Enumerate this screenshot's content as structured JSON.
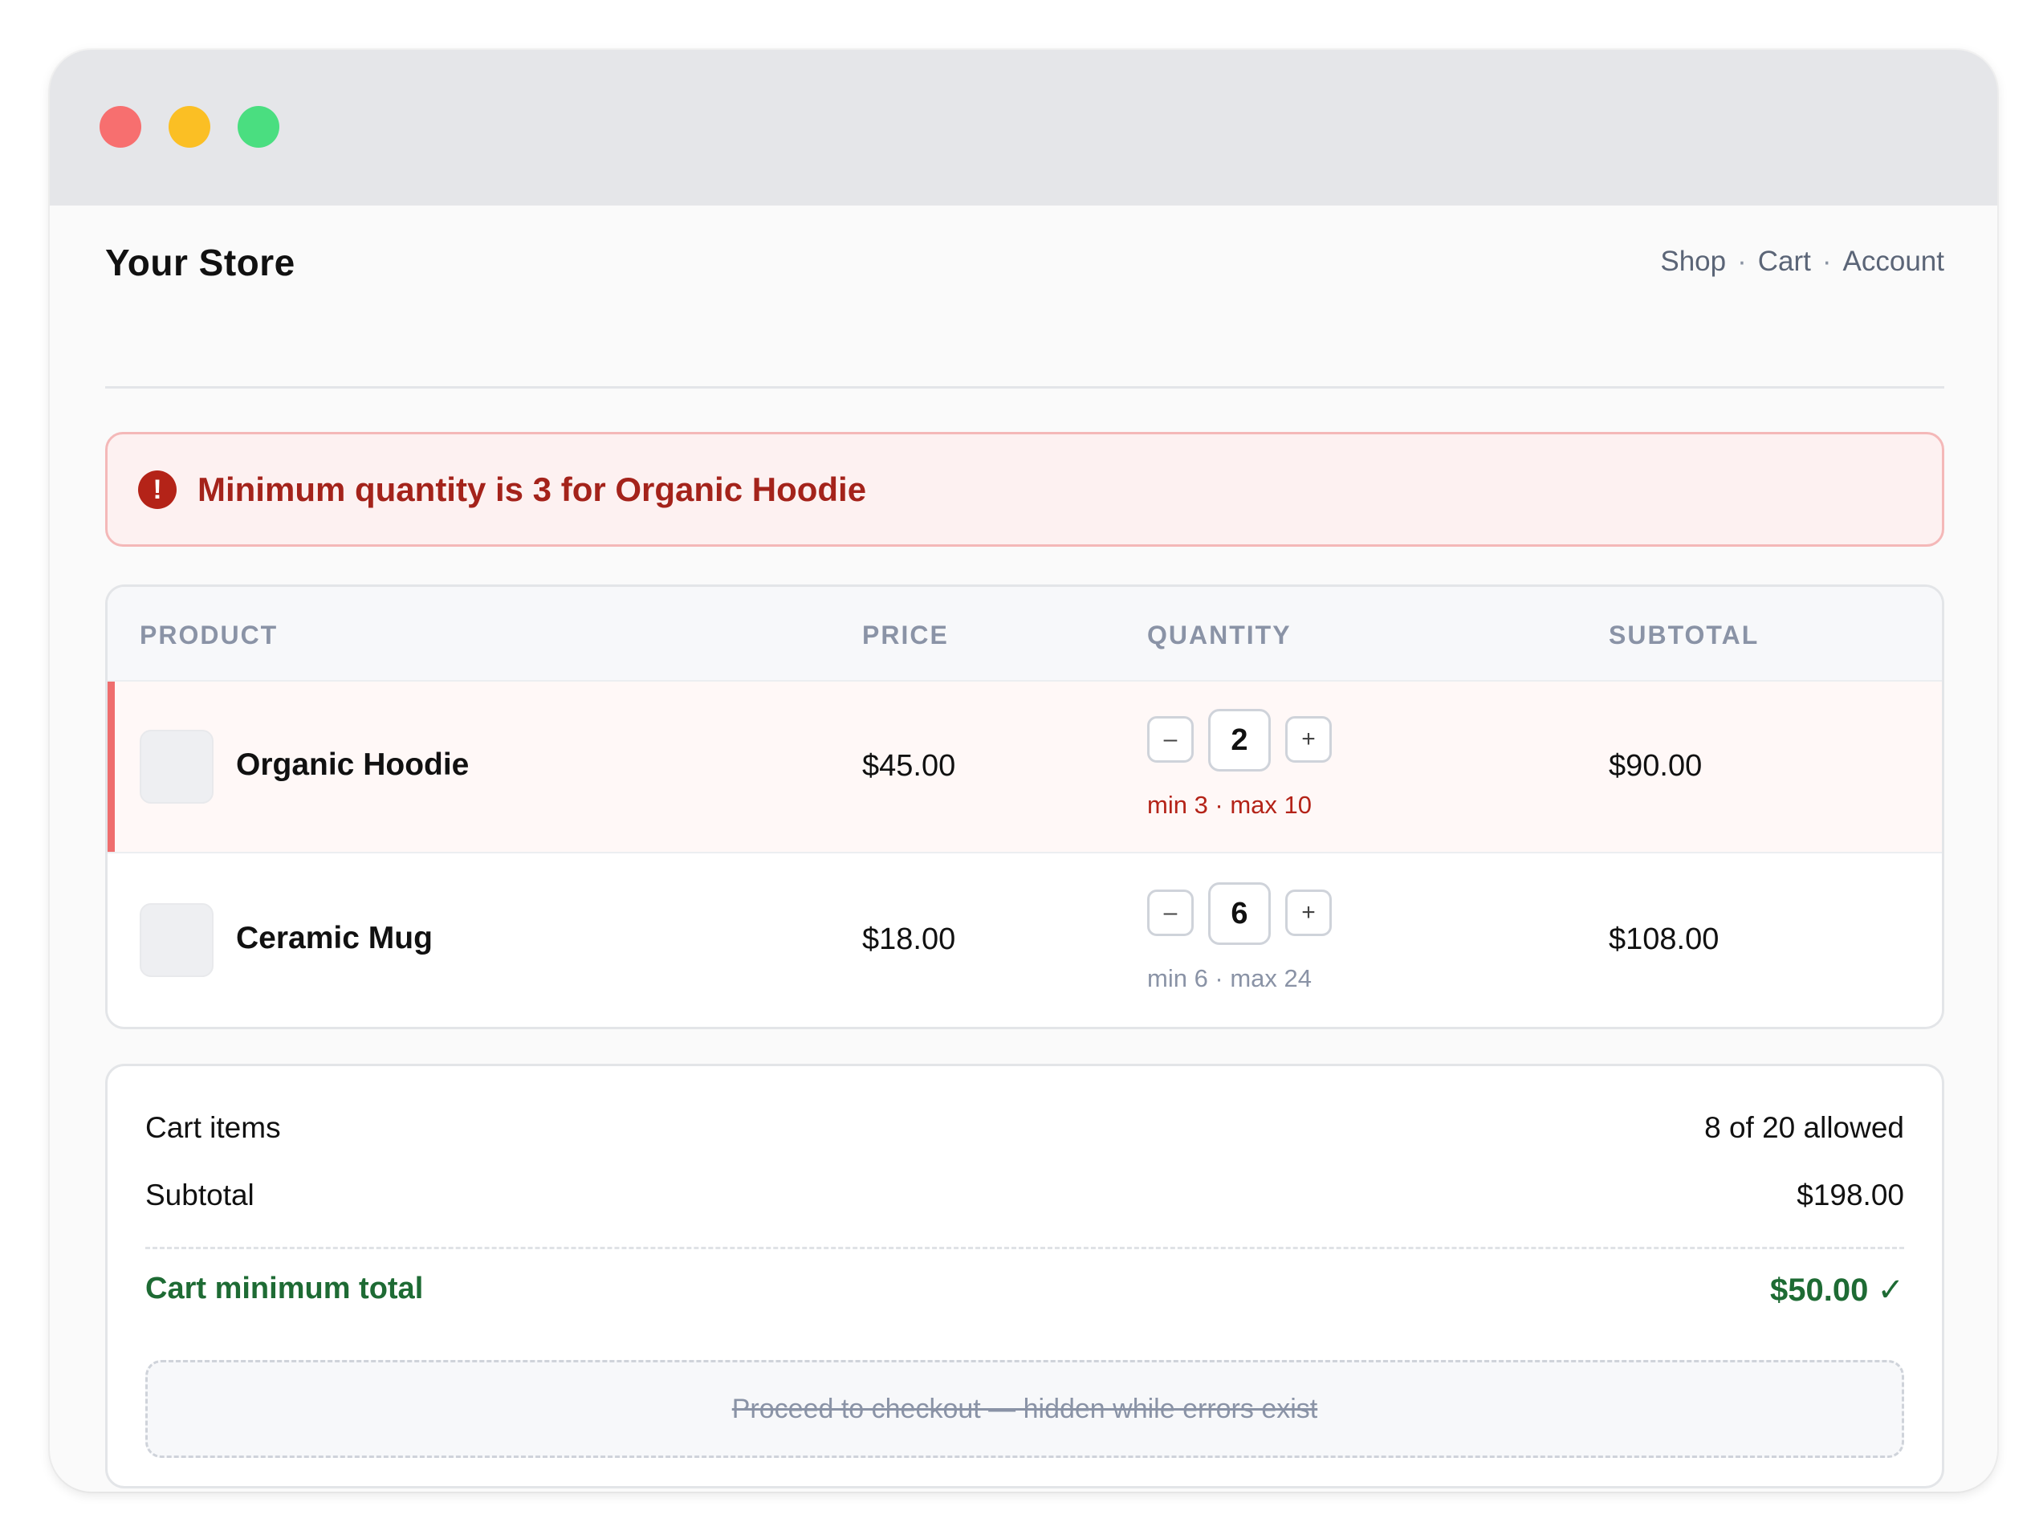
{
  "window": {
    "controls": [
      "close",
      "minimize",
      "maximize"
    ],
    "colors": {
      "close": "#f76f6f",
      "minimize": "#fbbf24",
      "maximize": "#4ade80"
    }
  },
  "header": {
    "brand": "Your Store",
    "nav": [
      {
        "label": "Shop"
      },
      {
        "label": "Cart"
      },
      {
        "label": "Account"
      }
    ],
    "nav_separator": "·"
  },
  "alert": {
    "icon": "error-exclamation-icon",
    "icon_glyph": "!",
    "message": "Minimum quantity is 3 for Organic Hoodie",
    "color": "#a4231b"
  },
  "table": {
    "columns": [
      "PRODUCT",
      "PRICE",
      "QUANTITY",
      "SUBTOTAL"
    ],
    "rows": [
      {
        "name": "Organic Hoodie",
        "price": "$45.00",
        "qty": "2",
        "limits": "min 3 · max 10",
        "subtotal": "$90.00",
        "error": true
      },
      {
        "name": "Ceramic Mug",
        "price": "$18.00",
        "qty": "6",
        "limits": "min 6 · max 24",
        "subtotal": "$108.00",
        "error": false
      }
    ],
    "decrement_label": "–",
    "increment_label": "+"
  },
  "summary": {
    "cart_items_label": "Cart items",
    "cart_items_value": "8 of 20 allowed",
    "subtotal_label": "Subtotal",
    "subtotal_value": "$198.00",
    "minimum_label": "Cart minimum total",
    "minimum_value": "$50.00 ✓",
    "minimum_color": "#1e6b34",
    "checkout_text": "Proceed to checkout — hidden while errors exist"
  }
}
